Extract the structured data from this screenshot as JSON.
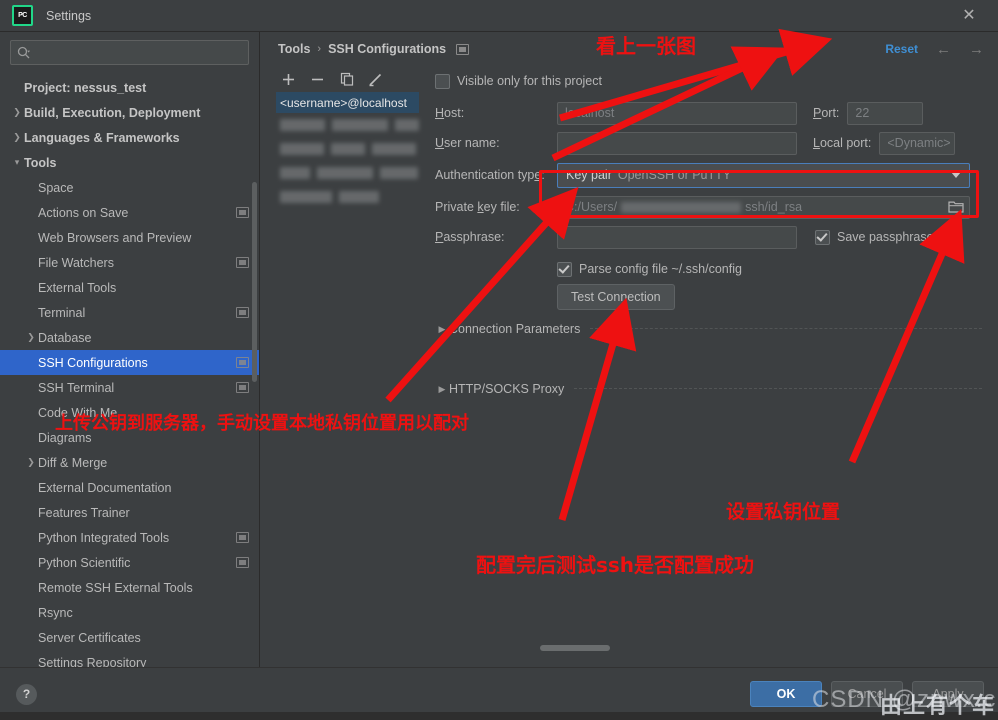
{
  "window": {
    "title": "Settings",
    "logo_text": "PC",
    "close_icon": "close-icon"
  },
  "sidebar": {
    "search": {
      "value": "",
      "placeholder": ""
    },
    "items": [
      {
        "label": "Project: nessus_test",
        "level": 0,
        "arrow": "none",
        "bold": true,
        "badge": false,
        "selected": false
      },
      {
        "label": "Build, Execution, Deployment",
        "level": 0,
        "arrow": "collapsed",
        "bold": true,
        "badge": false,
        "selected": false
      },
      {
        "label": "Languages & Frameworks",
        "level": 0,
        "arrow": "collapsed",
        "bold": true,
        "badge": false,
        "selected": false
      },
      {
        "label": "Tools",
        "level": 0,
        "arrow": "expanded",
        "bold": true,
        "badge": false,
        "selected": false
      },
      {
        "label": "Space",
        "level": 1,
        "arrow": "none",
        "bold": false,
        "badge": false,
        "selected": false
      },
      {
        "label": "Actions on Save",
        "level": 1,
        "arrow": "none",
        "bold": false,
        "badge": true,
        "selected": false
      },
      {
        "label": "Web Browsers and Preview",
        "level": 1,
        "arrow": "none",
        "bold": false,
        "badge": false,
        "selected": false
      },
      {
        "label": "File Watchers",
        "level": 1,
        "arrow": "none",
        "bold": false,
        "badge": true,
        "selected": false
      },
      {
        "label": "External Tools",
        "level": 1,
        "arrow": "none",
        "bold": false,
        "badge": false,
        "selected": false
      },
      {
        "label": "Terminal",
        "level": 1,
        "arrow": "none",
        "bold": false,
        "badge": true,
        "selected": false
      },
      {
        "label": "Database",
        "level": 1,
        "arrow": "collapsed",
        "bold": false,
        "badge": false,
        "selected": false
      },
      {
        "label": "SSH Configurations",
        "level": 1,
        "arrow": "none",
        "bold": false,
        "badge": true,
        "selected": true
      },
      {
        "label": "SSH Terminal",
        "level": 1,
        "arrow": "none",
        "bold": false,
        "badge": true,
        "selected": false
      },
      {
        "label": "Code With Me",
        "level": 1,
        "arrow": "none",
        "bold": false,
        "badge": false,
        "selected": false
      },
      {
        "label": "Diagrams",
        "level": 1,
        "arrow": "none",
        "bold": false,
        "badge": false,
        "selected": false
      },
      {
        "label": "Diff & Merge",
        "level": 1,
        "arrow": "collapsed",
        "bold": false,
        "badge": false,
        "selected": false
      },
      {
        "label": "External Documentation",
        "level": 1,
        "arrow": "none",
        "bold": false,
        "badge": false,
        "selected": false
      },
      {
        "label": "Features Trainer",
        "level": 1,
        "arrow": "none",
        "bold": false,
        "badge": false,
        "selected": false
      },
      {
        "label": "Python Integrated Tools",
        "level": 1,
        "arrow": "none",
        "bold": false,
        "badge": true,
        "selected": false
      },
      {
        "label": "Python Scientific",
        "level": 1,
        "arrow": "none",
        "bold": false,
        "badge": true,
        "selected": false
      },
      {
        "label": "Remote SSH External Tools",
        "level": 1,
        "arrow": "none",
        "bold": false,
        "badge": false,
        "selected": false
      },
      {
        "label": "Rsync",
        "level": 1,
        "arrow": "none",
        "bold": false,
        "badge": false,
        "selected": false
      },
      {
        "label": "Server Certificates",
        "level": 1,
        "arrow": "none",
        "bold": false,
        "badge": false,
        "selected": false
      },
      {
        "label": "Settings Repository",
        "level": 1,
        "arrow": "none",
        "bold": false,
        "badge": false,
        "selected": false
      }
    ]
  },
  "breadcrumb": {
    "parent": "Tools",
    "separator": "›",
    "current": "SSH Configurations",
    "reset_label": "Reset",
    "back_icon": "←",
    "forward_icon": "→"
  },
  "config_list": {
    "toolbar": {
      "add": "+",
      "remove": "−",
      "copy": "copy-icon",
      "edit": "pencil-icon"
    },
    "selected_item": "<username>@localhost",
    "blurred_rows": 4
  },
  "form": {
    "visible_only_checkbox": {
      "label": "Visible only for this project",
      "checked": false
    },
    "host": {
      "label": "Host:",
      "value": "",
      "placeholder": "localhost"
    },
    "port": {
      "label": "Port:",
      "value": "",
      "placeholder": "22"
    },
    "username": {
      "label": "User name:",
      "value": "",
      "placeholder": ""
    },
    "local_port": {
      "label": "Local port:",
      "value": "",
      "placeholder": "<Dynamic>"
    },
    "auth_type": {
      "label": "Authentication type:",
      "value": "Key pair",
      "hint": "OpenSSH or PuTTY"
    },
    "private_key": {
      "label": "Private key file:",
      "value_prefix": "C:/Users/",
      "value_suffix": "ssh/id_rsa",
      "browse_icon": "folder-icon"
    },
    "passphrase": {
      "label": "Passphrase:",
      "value": ""
    },
    "save_passphrase": {
      "label": "Save passphrase",
      "checked": true
    },
    "parse_config": {
      "label": "Parse config file ~/.ssh/config",
      "checked": true
    },
    "test_connection": "Test Connection",
    "sections": [
      {
        "title": "Connection Parameters",
        "expanded": false
      },
      {
        "title": "HTTP/SOCKS Proxy",
        "expanded": false
      }
    ]
  },
  "footer": {
    "help_icon": "?",
    "ok": "OK",
    "cancel": "Cancel",
    "apply": "Apply"
  },
  "annotations": {
    "top_note": "看上一张图",
    "left_note": "上传公钥到服务器，手动设置本地私钥位置用以配对",
    "right_note": "设置私钥位置",
    "bottom_note": "配置完后测试ssh是否配置成功",
    "color": "#ee1111"
  },
  "watermark": {
    "text": "CSDN @znwx.cn",
    "overlay_text": "由上有个车"
  }
}
